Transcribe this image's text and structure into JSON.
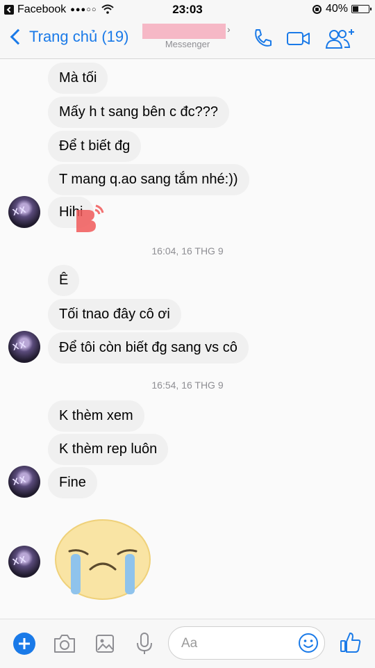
{
  "status_bar": {
    "back_app": "Facebook",
    "signal": "●●●○○",
    "time": "23:03",
    "battery": "40%",
    "battery_level": 0.4
  },
  "header": {
    "back_label": "Trang chủ (19)",
    "subtitle": "Messenger",
    "icons": [
      "phone-icon",
      "video-icon",
      "add-people-icon"
    ]
  },
  "messages": [
    {
      "text": "Mà tối"
    },
    {
      "text": "Mấy h t sang bên c đc???"
    },
    {
      "text": "Để t biết đg"
    },
    {
      "text": "T mang q.ao sang tắm nhé:))"
    },
    {
      "text": "Hihi"
    },
    {
      "text": "Ê"
    },
    {
      "text": "Tối tnao đây cô ơi"
    },
    {
      "text": "Để tôi còn biết đg sang vs cô"
    },
    {
      "text": "K thèm xem"
    },
    {
      "text": "K thèm rep luôn"
    },
    {
      "text": "Fine"
    }
  ],
  "timestamps": [
    "16:04, 16 THG 9",
    "16:54, 16 THG 9"
  ],
  "avatar_text": "X X",
  "sticker": "crying-face-sticker",
  "composer": {
    "placeholder": "Aa",
    "icons": [
      "plus-icon",
      "camera-icon",
      "image-icon",
      "microphone-icon",
      "emoji-icon",
      "like-icon"
    ]
  },
  "colors": {
    "accent": "#1a7ae8",
    "bubble": "#f0f0f0",
    "redacted": "#f6b8c6"
  }
}
